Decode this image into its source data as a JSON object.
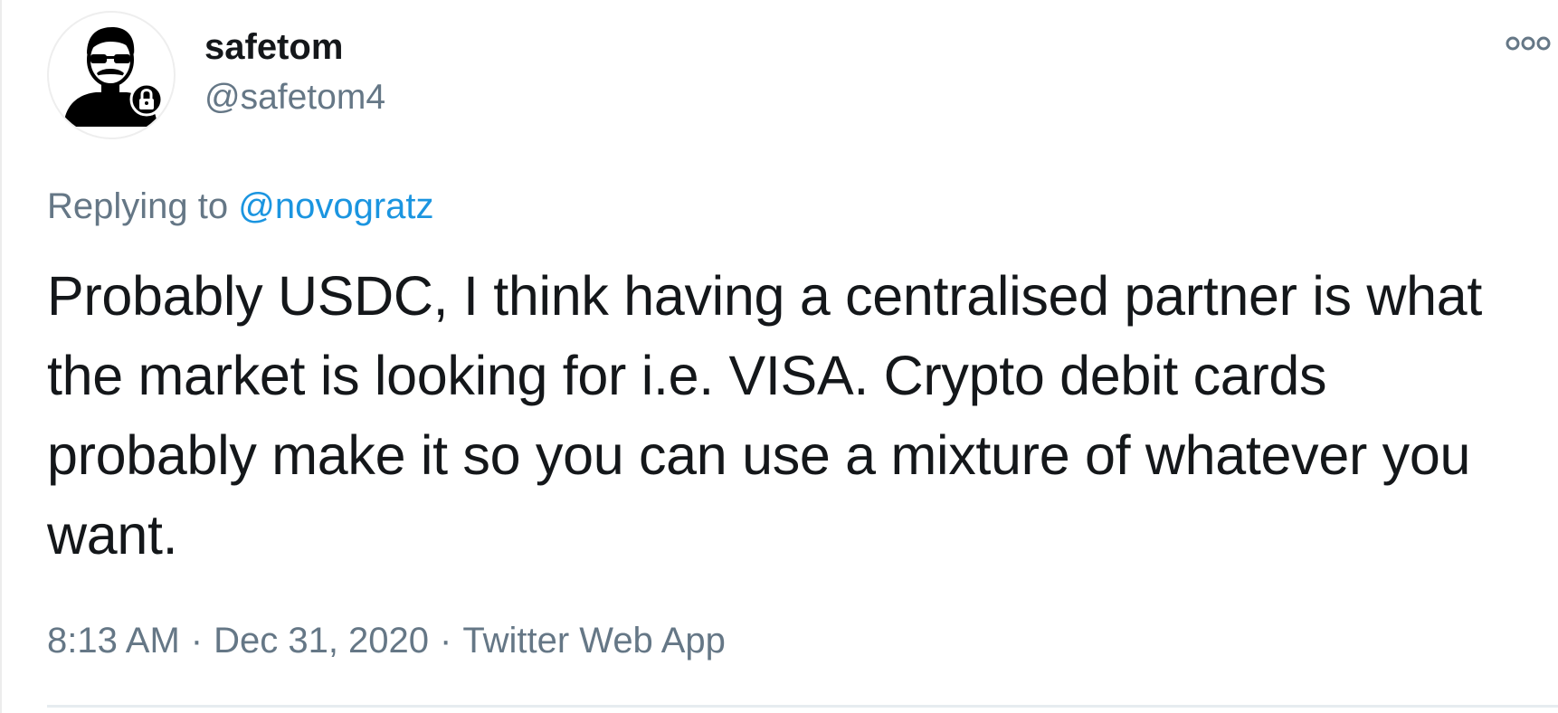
{
  "tweet": {
    "author": {
      "display_name": "safetom",
      "handle": "@safetom4",
      "avatar_icon": "masked-man-with-lock-icon"
    },
    "replying_prefix": "Replying to",
    "replying_to": "@novogratz",
    "text": "Probably USDC, I think having a centralised partner is what the market is looking for i.e. VISA. Crypto debit cards probably make it so you can use a mixture of whatever you want.",
    "time": "8:13 AM",
    "separator": "·",
    "date": "Dec 31, 2020",
    "source": "Twitter Web App",
    "more_icon": "more-options-icon"
  },
  "colors": {
    "text_primary": "#14171a",
    "text_secondary": "#657786",
    "link": "#1b95e0",
    "divider": "#e6ecf0"
  }
}
